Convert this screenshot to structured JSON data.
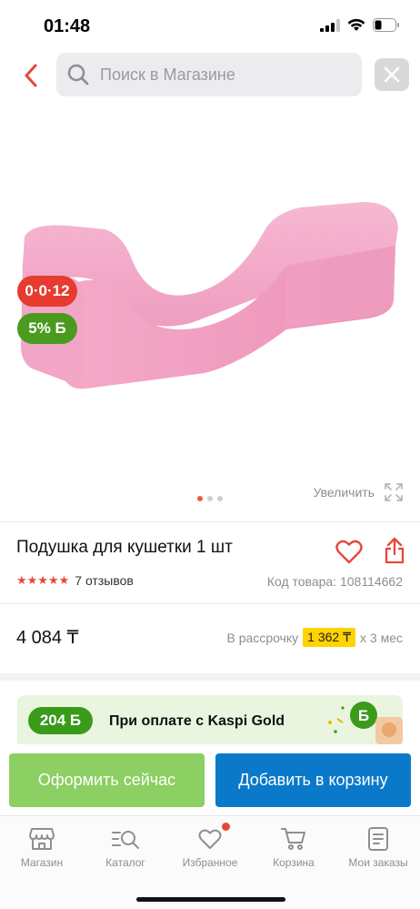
{
  "status_bar": {
    "time": "01:48"
  },
  "search": {
    "placeholder": "Поиск в Магазине"
  },
  "gallery": {
    "badge_timer": "0·0·12",
    "badge_bonus": "5% Б",
    "zoom_label": "Увеличить",
    "image_count": 3,
    "active_image": 1
  },
  "product": {
    "title": "Подушка для кушетки 1 шт",
    "rating": 5,
    "stars": "★★★★★",
    "reviews": "7 отзывов",
    "code": "Код товара: 108114662",
    "price": "4 084 ₸",
    "installment_prefix": "В рассрочку",
    "installment_amount": "1 362 ₸",
    "installment_suffix": "х 3 мес"
  },
  "promo": {
    "bonus": "204 Б",
    "text": "При оплате с Kaspi Gold"
  },
  "actions": {
    "checkout": "Оформить сейчас",
    "add_to_cart": "Добавить в корзину"
  },
  "tabs": [
    {
      "label": "Магазин",
      "icon": "store-icon"
    },
    {
      "label": "Каталог",
      "icon": "catalog-search-icon"
    },
    {
      "label": "Избранное",
      "icon": "heart-icon"
    },
    {
      "label": "Корзина",
      "icon": "cart-icon"
    },
    {
      "label": "Мои заказы",
      "icon": "orders-icon"
    }
  ],
  "colors": {
    "accent_red": "#e8463a",
    "kaspi_blue": "#0b79c9",
    "checkout_green": "#8ccf62",
    "bonus_green": "#3a9a1a",
    "installment_yellow": "#ffd300",
    "product_pink": "#f4a8c6"
  }
}
